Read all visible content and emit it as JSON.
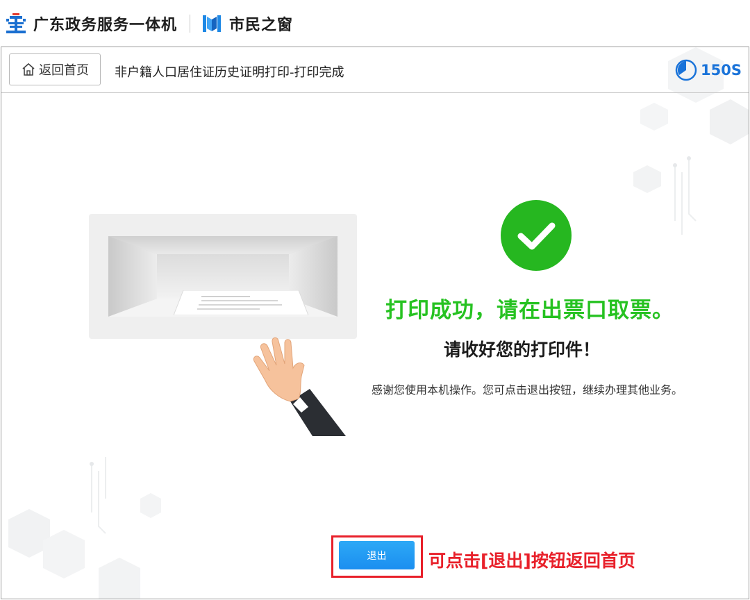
{
  "brand": {
    "name": "广东政务服务一体机",
    "sub_name": "市民之窗"
  },
  "title_bar": {
    "home_label": "返回首页",
    "page_title": "非户籍人口居住证历史证明打印-打印完成",
    "timer": "150S"
  },
  "result": {
    "headline": "打印成功，请在出票口取票。",
    "subline": "请收好您的打印件！",
    "tip": "感谢您使用本机操作。您可点击退出按钮，继续办理其他业务。"
  },
  "exit": {
    "button_label": "退出",
    "hint": "可点击[退出]按钮返回首页"
  },
  "colors": {
    "success_green": "#26c221",
    "accent_blue": "#1a73d9",
    "highlight_red": "#e8202a",
    "button_blue": "#1b8ef0"
  },
  "icons": [
    "gov-logo-icon",
    "window-logo-icon",
    "home-icon",
    "clock-icon",
    "checkmark-icon",
    "hand-icon"
  ]
}
